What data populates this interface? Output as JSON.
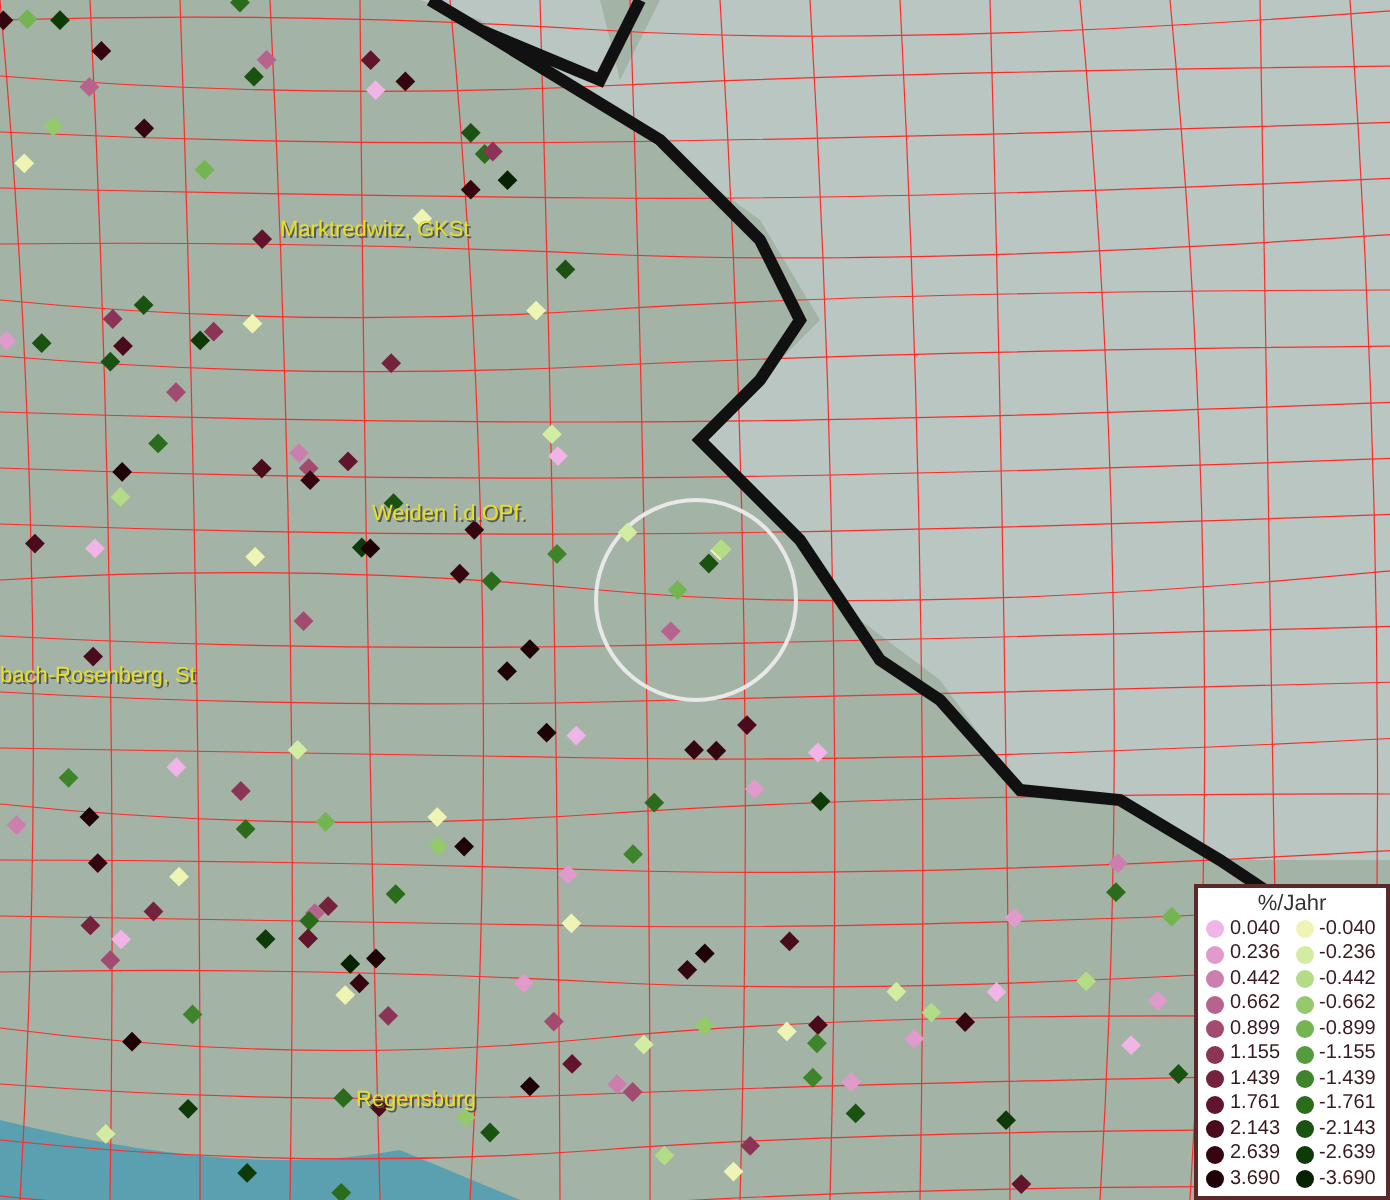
{
  "map_labels": [
    "Marktredwitz, GKSt",
    "Weiden i.d.OPf.",
    "bach-Rosenberg, St",
    "Regensburg"
  ],
  "legend": {
    "title": "%/Jahr",
    "items": [
      {
        "label": "0.040",
        "color": "#f0b4e6"
      },
      {
        "label": "-0.040",
        "color": "#eef5b4"
      },
      {
        "label": "0.236",
        "color": "#e09acb"
      },
      {
        "label": "-0.236",
        "color": "#d2eca2"
      },
      {
        "label": "0.442",
        "color": "#cc7fae"
      },
      {
        "label": "-0.442",
        "color": "#b2dc86"
      },
      {
        "label": "0.662",
        "color": "#b8638e"
      },
      {
        "label": "-0.662",
        "color": "#94ca6c"
      },
      {
        "label": "0.899",
        "color": "#a24a70"
      },
      {
        "label": "-0.899",
        "color": "#74b552"
      },
      {
        "label": "1.155",
        "color": "#8c3455"
      },
      {
        "label": "-1.155",
        "color": "#559c3c"
      },
      {
        "label": "1.439",
        "color": "#75223f"
      },
      {
        "label": "-1.439",
        "color": "#3d842b"
      },
      {
        "label": "1.761",
        "color": "#60152c"
      },
      {
        "label": "-1.761",
        "color": "#2a6b1c"
      },
      {
        "label": "2.143",
        "color": "#4a0c1c"
      },
      {
        "label": "-2.143",
        "color": "#1a5211"
      },
      {
        "label": "2.639",
        "color": "#350610"
      },
      {
        "label": "-2.639",
        "color": "#0e3a08"
      },
      {
        "label": "3.690",
        "color": "#1e0206"
      },
      {
        "label": "-3.690",
        "color": "#062203"
      }
    ]
  }
}
